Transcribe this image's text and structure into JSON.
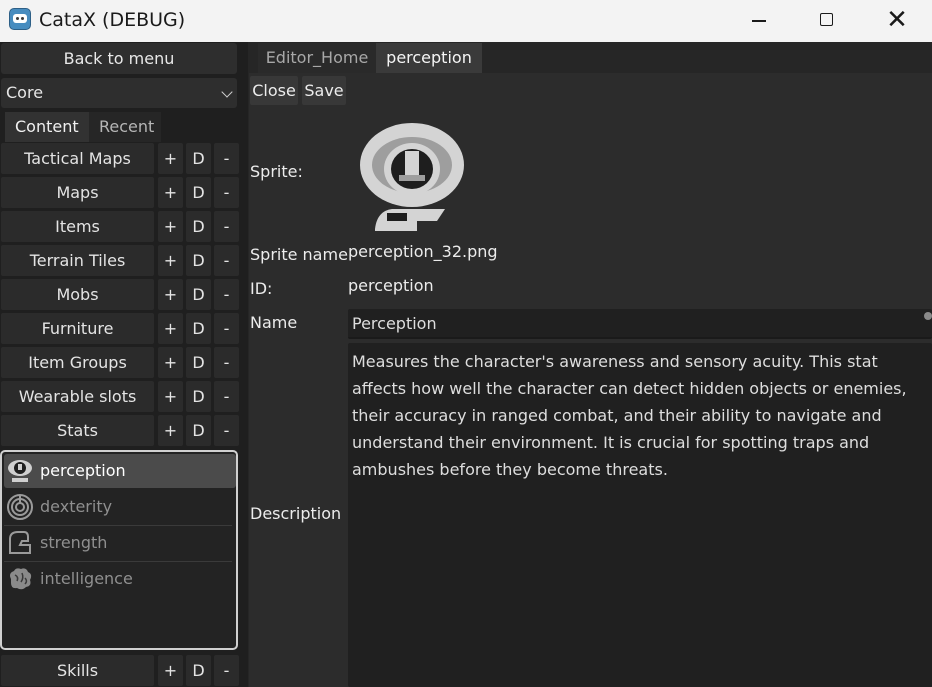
{
  "window": {
    "title": "CataX (DEBUG)"
  },
  "left": {
    "back_label": "Back to menu",
    "mod_select": "Core",
    "tabs": [
      {
        "label": "Content"
      },
      {
        "label": "Recent"
      }
    ],
    "categories": [
      {
        "label": "Tactical Maps"
      },
      {
        "label": "Maps"
      },
      {
        "label": "Items"
      },
      {
        "label": "Terrain Tiles"
      },
      {
        "label": "Mobs"
      },
      {
        "label": "Furniture"
      },
      {
        "label": "Item Groups"
      },
      {
        "label": "Wearable slots"
      },
      {
        "label": "Stats"
      }
    ],
    "row_buttons": {
      "add": "+",
      "dup": "D",
      "del": "-"
    },
    "stats_list": [
      {
        "label": "perception",
        "icon": "eye-icon",
        "selected": true
      },
      {
        "label": "dexterity",
        "icon": "maze-icon",
        "selected": false
      },
      {
        "label": "strength",
        "icon": "arm-icon",
        "selected": false
      },
      {
        "label": "intelligence",
        "icon": "brain-icon",
        "selected": false
      }
    ],
    "bottom_category": {
      "label": "Skills"
    }
  },
  "editor": {
    "tabs": [
      {
        "label": "Editor_Home"
      },
      {
        "label": "perception"
      }
    ],
    "actions": {
      "close": "Close",
      "save": "Save"
    },
    "fields": {
      "sprite_label": "Sprite:",
      "sprite_name_label": "Sprite name",
      "sprite_name": "perception_32.png",
      "id_label": "ID:",
      "id": "perception",
      "name_label": "Name",
      "name": "Perception",
      "description_label": "Description",
      "description": "Measures the character's awareness and sensory acuity. This stat affects how well the character can detect hidden objects or enemies, their accuracy in ranged combat, and their ability to navigate and understand their environment. It is crucial for spotting traps and ambushes before they become threats."
    }
  },
  "colors": {
    "background": "#1f1f1f",
    "panel": "#2c2c2c",
    "selected": "#4b4b4b",
    "titlebar": "#f3f3f3"
  }
}
